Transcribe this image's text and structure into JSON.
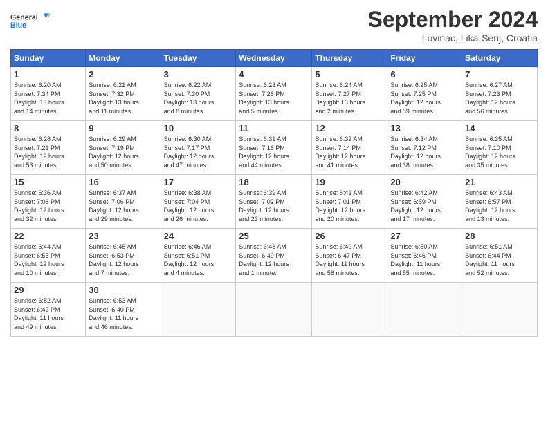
{
  "header": {
    "logo_line1": "General",
    "logo_line2": "Blue",
    "month": "September 2024",
    "location": "Lovinac, Lika-Senj, Croatia"
  },
  "weekdays": [
    "Sunday",
    "Monday",
    "Tuesday",
    "Wednesday",
    "Thursday",
    "Friday",
    "Saturday"
  ],
  "weeks": [
    [
      {
        "day": "1",
        "info": "Sunrise: 6:20 AM\nSunset: 7:34 PM\nDaylight: 13 hours\nand 14 minutes."
      },
      {
        "day": "2",
        "info": "Sunrise: 6:21 AM\nSunset: 7:32 PM\nDaylight: 13 hours\nand 11 minutes."
      },
      {
        "day": "3",
        "info": "Sunrise: 6:22 AM\nSunset: 7:30 PM\nDaylight: 13 hours\nand 8 minutes."
      },
      {
        "day": "4",
        "info": "Sunrise: 6:23 AM\nSunset: 7:28 PM\nDaylight: 13 hours\nand 5 minutes."
      },
      {
        "day": "5",
        "info": "Sunrise: 6:24 AM\nSunset: 7:27 PM\nDaylight: 13 hours\nand 2 minutes."
      },
      {
        "day": "6",
        "info": "Sunrise: 6:25 AM\nSunset: 7:25 PM\nDaylight: 12 hours\nand 59 minutes."
      },
      {
        "day": "7",
        "info": "Sunrise: 6:27 AM\nSunset: 7:23 PM\nDaylight: 12 hours\nand 56 minutes."
      }
    ],
    [
      {
        "day": "8",
        "info": "Sunrise: 6:28 AM\nSunset: 7:21 PM\nDaylight: 12 hours\nand 53 minutes."
      },
      {
        "day": "9",
        "info": "Sunrise: 6:29 AM\nSunset: 7:19 PM\nDaylight: 12 hours\nand 50 minutes."
      },
      {
        "day": "10",
        "info": "Sunrise: 6:30 AM\nSunset: 7:17 PM\nDaylight: 12 hours\nand 47 minutes."
      },
      {
        "day": "11",
        "info": "Sunrise: 6:31 AM\nSunset: 7:16 PM\nDaylight: 12 hours\nand 44 minutes."
      },
      {
        "day": "12",
        "info": "Sunrise: 6:32 AM\nSunset: 7:14 PM\nDaylight: 12 hours\nand 41 minutes."
      },
      {
        "day": "13",
        "info": "Sunrise: 6:34 AM\nSunset: 7:12 PM\nDaylight: 12 hours\nand 38 minutes."
      },
      {
        "day": "14",
        "info": "Sunrise: 6:35 AM\nSunset: 7:10 PM\nDaylight: 12 hours\nand 35 minutes."
      }
    ],
    [
      {
        "day": "15",
        "info": "Sunrise: 6:36 AM\nSunset: 7:08 PM\nDaylight: 12 hours\nand 32 minutes."
      },
      {
        "day": "16",
        "info": "Sunrise: 6:37 AM\nSunset: 7:06 PM\nDaylight: 12 hours\nand 29 minutes."
      },
      {
        "day": "17",
        "info": "Sunrise: 6:38 AM\nSunset: 7:04 PM\nDaylight: 12 hours\nand 26 minutes."
      },
      {
        "day": "18",
        "info": "Sunrise: 6:39 AM\nSunset: 7:02 PM\nDaylight: 12 hours\nand 23 minutes."
      },
      {
        "day": "19",
        "info": "Sunrise: 6:41 AM\nSunset: 7:01 PM\nDaylight: 12 hours\nand 20 minutes."
      },
      {
        "day": "20",
        "info": "Sunrise: 6:42 AM\nSunset: 6:59 PM\nDaylight: 12 hours\nand 17 minutes."
      },
      {
        "day": "21",
        "info": "Sunrise: 6:43 AM\nSunset: 6:57 PM\nDaylight: 12 hours\nand 13 minutes."
      }
    ],
    [
      {
        "day": "22",
        "info": "Sunrise: 6:44 AM\nSunset: 6:55 PM\nDaylight: 12 hours\nand 10 minutes."
      },
      {
        "day": "23",
        "info": "Sunrise: 6:45 AM\nSunset: 6:53 PM\nDaylight: 12 hours\nand 7 minutes."
      },
      {
        "day": "24",
        "info": "Sunrise: 6:46 AM\nSunset: 6:51 PM\nDaylight: 12 hours\nand 4 minutes."
      },
      {
        "day": "25",
        "info": "Sunrise: 6:48 AM\nSunset: 6:49 PM\nDaylight: 12 hours\nand 1 minute."
      },
      {
        "day": "26",
        "info": "Sunrise: 6:49 AM\nSunset: 6:47 PM\nDaylight: 11 hours\nand 58 minutes."
      },
      {
        "day": "27",
        "info": "Sunrise: 6:50 AM\nSunset: 6:46 PM\nDaylight: 11 hours\nand 55 minutes."
      },
      {
        "day": "28",
        "info": "Sunrise: 6:51 AM\nSunset: 6:44 PM\nDaylight: 11 hours\nand 52 minutes."
      }
    ],
    [
      {
        "day": "29",
        "info": "Sunrise: 6:52 AM\nSunset: 6:42 PM\nDaylight: 11 hours\nand 49 minutes."
      },
      {
        "day": "30",
        "info": "Sunrise: 6:53 AM\nSunset: 6:40 PM\nDaylight: 11 hours\nand 46 minutes."
      },
      {
        "day": "",
        "info": ""
      },
      {
        "day": "",
        "info": ""
      },
      {
        "day": "",
        "info": ""
      },
      {
        "day": "",
        "info": ""
      },
      {
        "day": "",
        "info": ""
      }
    ]
  ]
}
